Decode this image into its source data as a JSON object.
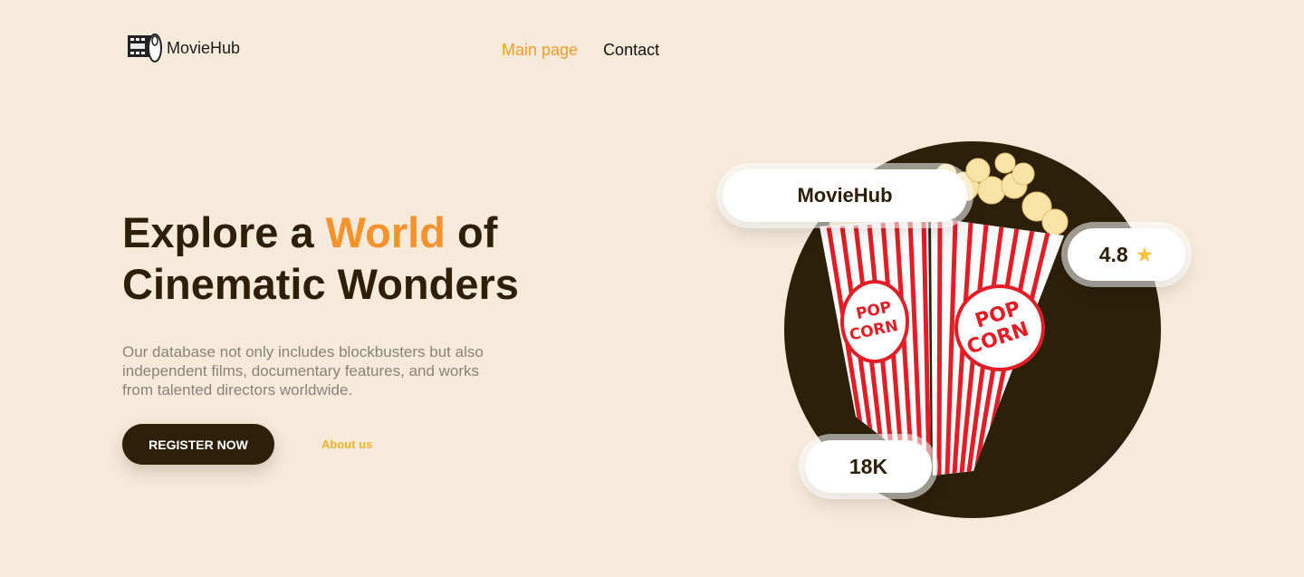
{
  "brand": {
    "name": "MovieHub",
    "logo_icon": "film-reel-icon"
  },
  "nav": {
    "items": [
      {
        "label": "Main page",
        "active": true
      },
      {
        "label": "Contact",
        "active": false
      }
    ]
  },
  "hero": {
    "title_line1_prefix": "Explore a",
    "title_highlight": "World",
    "title_line1_suffix": "of",
    "title_line2": "Cinematic Wonders",
    "description": "Our database not only includes blockbusters but also independent films, documentary features, and works from talented directors worldwide.",
    "register_label": "REGISTER NOW",
    "about_label": "About us"
  },
  "badges": {
    "brand": "MovieHub",
    "rating": "4.8",
    "rating_icon": "star-icon",
    "count": "18K"
  },
  "colors": {
    "background": "#f6eadb",
    "dark": "#2e2008",
    "accent": "#f5922b",
    "link": "#f0b42a",
    "popcorn_red": "#e31d25"
  }
}
